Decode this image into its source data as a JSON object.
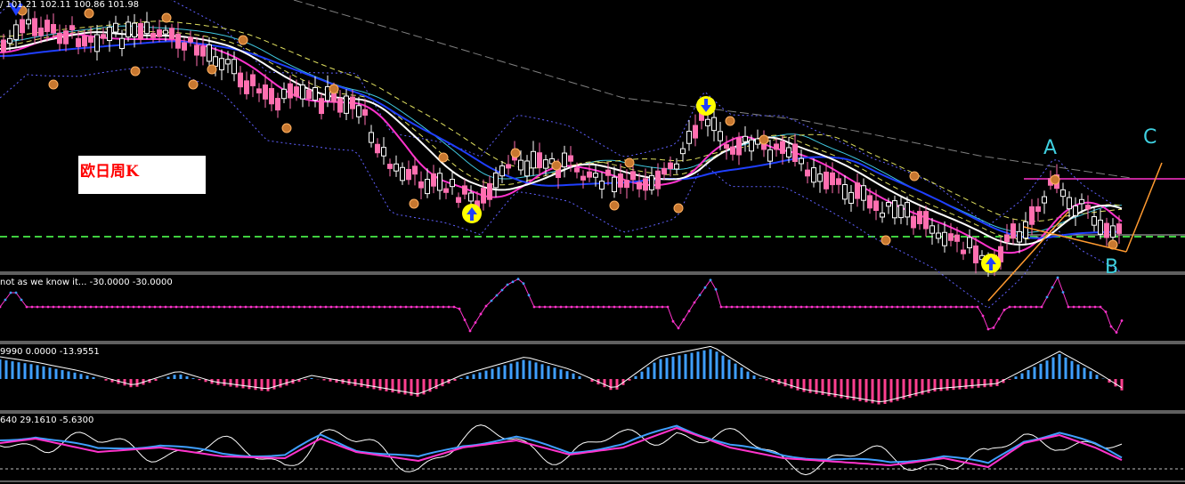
{
  "header": {
    "price_readout": "/  101.21 102.11 100.86 101.98"
  },
  "symbol_label": "欧日周K",
  "wave_labels": {
    "a": "A",
    "b": "B",
    "c": "C"
  },
  "panes": {
    "indicator1_label": "not as we know it... -30.0000 -30.0000",
    "indicator2_label": "9990 0.0000 -13.9551",
    "indicator3_label": "640 29.1610 -5.6300"
  },
  "colors": {
    "background": "#000000",
    "bull_candle": "#ffffff",
    "bear_candle": "#ff6fb0",
    "ma_white": "#ffffff",
    "ma_blue": "#1f3fff",
    "ma_magenta": "#ff33cc",
    "ma_cyan": "#40c8e0",
    "ma_yellow_dash": "#e0e060",
    "band_dotted": "#6060ff",
    "long_ma_gray": "#808080",
    "support_green": "#3fcf3f",
    "resistance_magenta": "#ff33cc",
    "orange_channel": "#ff9a30",
    "wave_label": "#3fd0e0",
    "hist_up": "#3f9fff",
    "hist_down": "#ff3f8f"
  },
  "icons": {
    "arrow_up": "yellow-circle-up-arrow-icon",
    "arrow_down": "yellow-circle-down-arrow-icon",
    "fractal": "orange-fractal-marker-icon"
  }
}
